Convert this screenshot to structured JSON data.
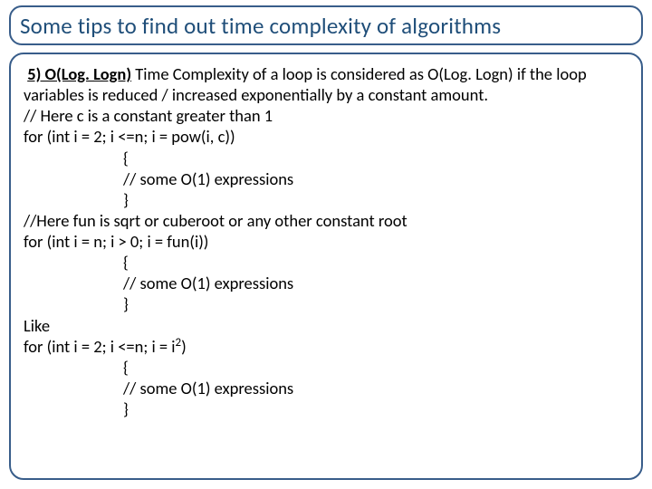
{
  "title": "Some tips to find out time complexity of algorithms",
  "item": {
    "label": "5) O(Log. Logn)",
    "intro_rest": " Time Complexity of a loop is considered as O(Log. Logn) if the loop variables is reduced / increased exponentially by a constant amount."
  },
  "lines": {
    "c1": "// Here c is a constant greater than 1",
    "for1": "for (int i = 2; i <=n; i = pow(i, c))",
    "brace_open": "{",
    "expr": "// some O(1) expressions",
    "brace_close": "}",
    "c2": "//Here fun is sqrt or cuberoot or any other constant root",
    "for2": "for (int i = n; i > 0; i = fun(i))",
    "like": "Like",
    "for3_a": "for (int i = 2; i <=n; i = i",
    "for3_b": ")"
  }
}
